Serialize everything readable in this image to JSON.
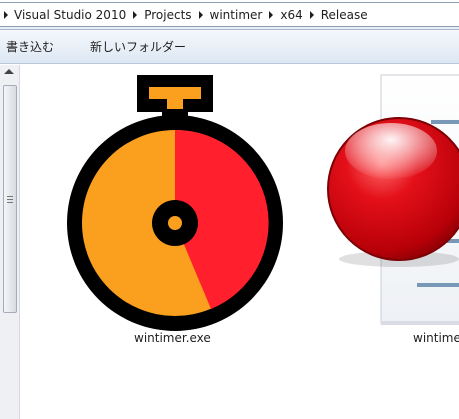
{
  "address_bar": {
    "crumbs": [
      "Visual Studio 2010",
      "Projects",
      "wintimer",
      "x64",
      "Release"
    ]
  },
  "command_bar": {
    "burn_label": "書き込む",
    "new_folder_label": "新しいフォルダー"
  },
  "files": [
    {
      "name": "wintimer.exe",
      "icon": "stopwatch-icon"
    },
    {
      "name": "wintime",
      "icon": "document-red-ball-icon"
    }
  ],
  "colors": {
    "stopwatch_orange": "#fa9f1e",
    "stopwatch_red": "#ff1f2d",
    "ball_red": "#d4000a"
  }
}
